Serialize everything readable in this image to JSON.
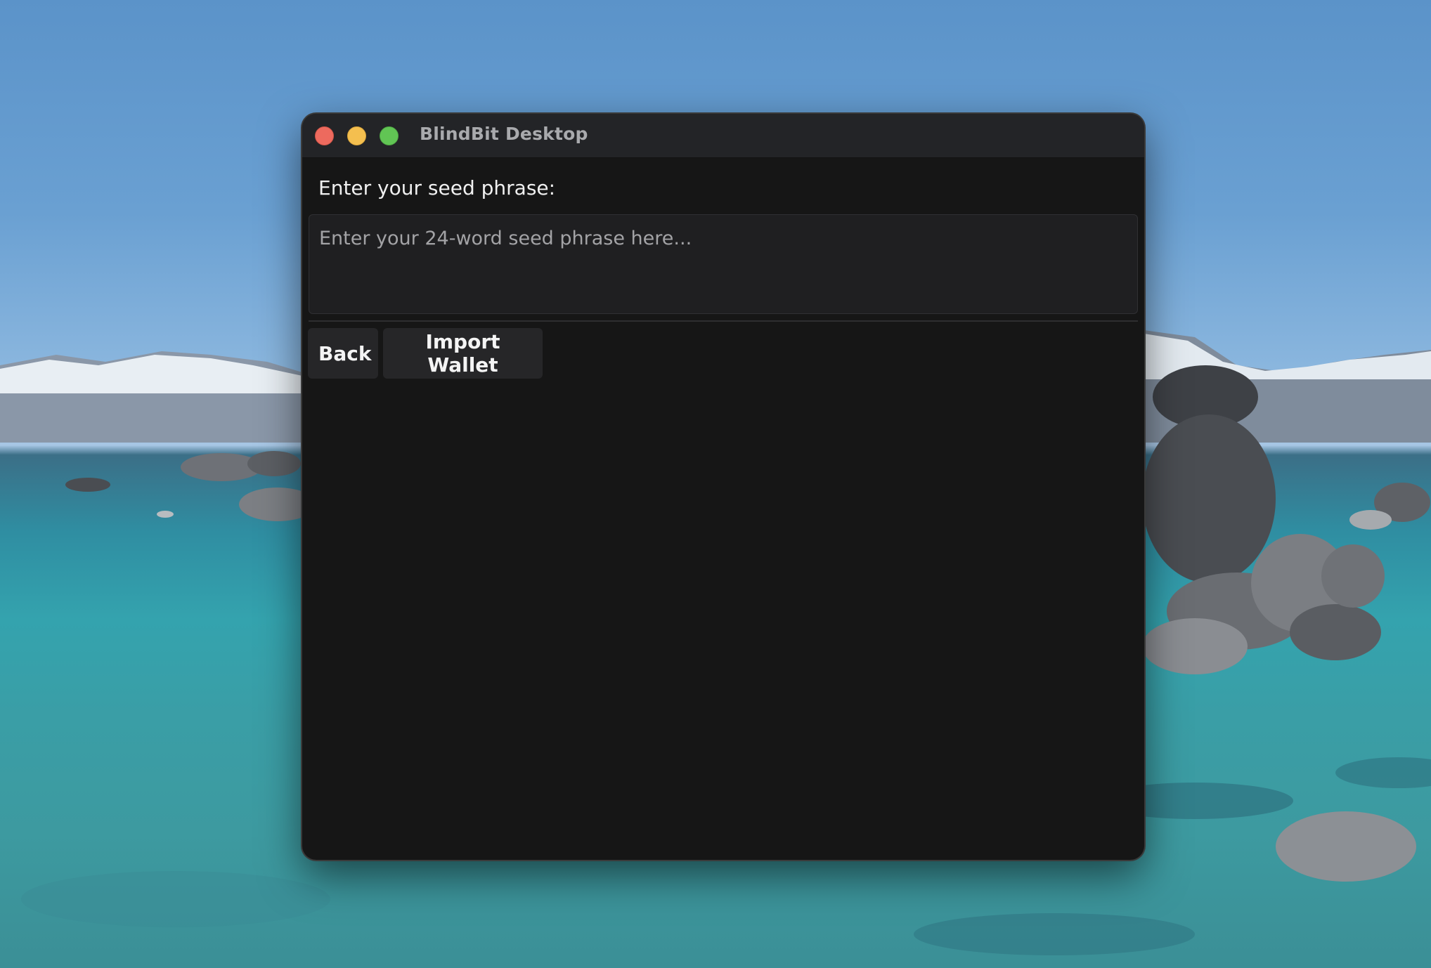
{
  "window": {
    "title": "BlindBit Desktop"
  },
  "import_screen": {
    "prompt_label": "Enter your seed phrase:",
    "seed_input": {
      "value": "",
      "placeholder": "Enter your 24-word seed phrase here..."
    },
    "buttons": {
      "back_label": "Back",
      "import_label": "Import Wallet"
    }
  },
  "icons": {
    "close": "close-traffic-light-icon",
    "minimize": "minimize-traffic-light-icon",
    "maximize": "maximize-traffic-light-icon"
  },
  "colors": {
    "close": "#ed6a5e",
    "minimize": "#f4bf4f",
    "maximize": "#61c554",
    "window_background": "#161616",
    "titlebar_background": "#232427"
  }
}
